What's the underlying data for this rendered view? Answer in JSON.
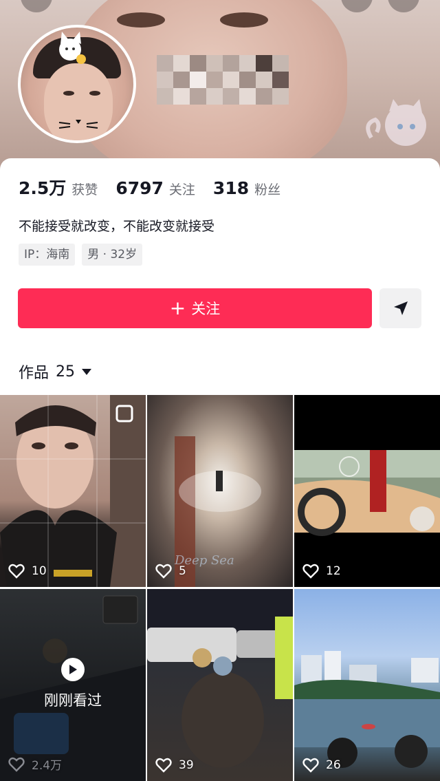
{
  "profile": {
    "stats": [
      {
        "value": "2.5万",
        "label": "获赞"
      },
      {
        "value": "6797",
        "label": "关注"
      },
      {
        "value": "318",
        "label": "粉丝"
      }
    ],
    "bio": "不能接受就改变，不能改变就接受",
    "tags": [
      "IP：海南",
      "男 · 32岁"
    ]
  },
  "actions": {
    "follow_label": "关注",
    "follow_plus": "+",
    "share_icon": "send-icon"
  },
  "works": {
    "label": "作品",
    "count": "25",
    "items": [
      {
        "likes": "10"
      },
      {
        "likes": "5"
      },
      {
        "likes": "12"
      },
      {
        "likes": "2.4万",
        "badge": "刚刚看过"
      },
      {
        "likes": "39"
      },
      {
        "likes": "26"
      }
    ]
  },
  "colors": {
    "accent": "#fe2c55",
    "text": "#161823",
    "muted": "#6b6d74",
    "chip": "#f1f1f2"
  }
}
